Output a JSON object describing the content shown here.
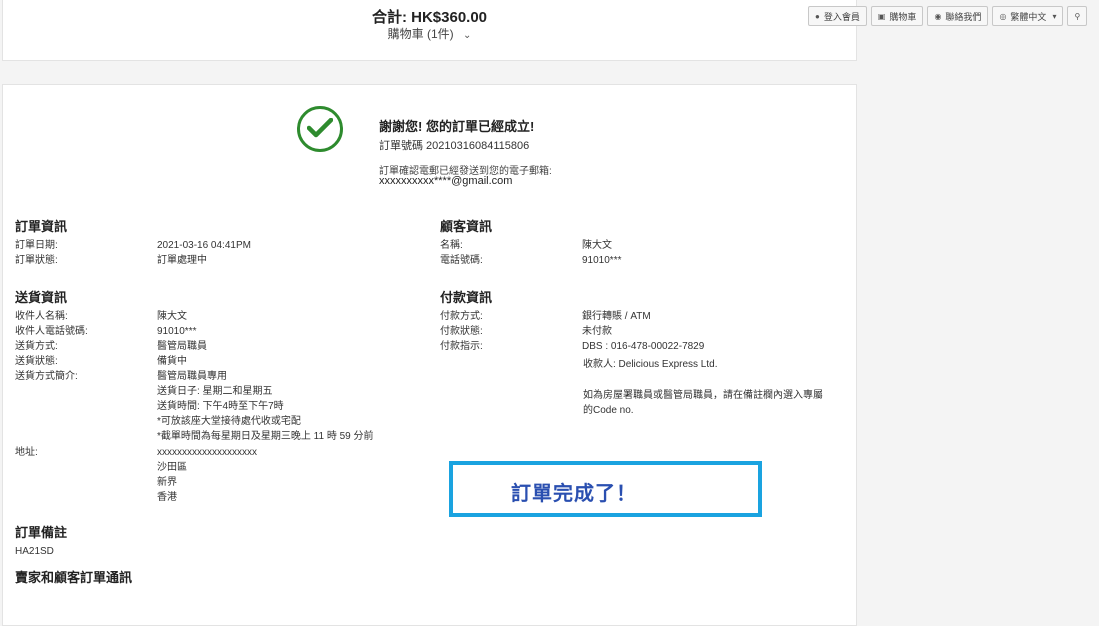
{
  "cart": {
    "total": "合計: HK$360.00",
    "items": "購物車 (1件)"
  },
  "nav": {
    "login": "登入會員",
    "cart": "購物車",
    "contact": "聯絡我們",
    "language": "繁體中文"
  },
  "success": {
    "title": "謝謝您!  您的訂單已經成立!",
    "order_number": "訂單號碼 20210316084115806",
    "confirm_text": "訂單確認電郵已經發送到您的電子郵箱:",
    "email": "xxxxxxxxxx****@gmail.com"
  },
  "order_info": {
    "heading": "訂單資訊",
    "rows": [
      {
        "label": "訂單日期:",
        "value": "2021-03-16 04:41PM"
      },
      {
        "label": "訂單狀態:",
        "value": "訂單處理中"
      }
    ]
  },
  "customer_info": {
    "heading": "顧客資訊",
    "rows": [
      {
        "label": "名稱:",
        "value": "陳大文"
      },
      {
        "label": "電話號碼:",
        "value": "91010***"
      }
    ]
  },
  "delivery_info": {
    "heading": "送貨資訊",
    "rows": [
      {
        "label": "收件人名稱:",
        "value": "陳大文"
      },
      {
        "label": "收件人電話號碼:",
        "value": "91010***"
      },
      {
        "label": "送貨方式:",
        "value": "醫管局職員"
      },
      {
        "label": "送貨狀態:",
        "value": "備貨中"
      },
      {
        "label": "送貨方式簡介:",
        "value": "醫管局職員專用"
      }
    ],
    "desc_lines": [
      "送貨日子: 星期二和星期五",
      "送貨時間: 下午4時至下午7時",
      "*可放該座大堂接待處代收或宅配",
      "*截單時間為每星期日及星期三晚上 11 時 59 分前"
    ],
    "address_label": "地址:",
    "address_lines": [
      "xxxxxxxxxxxxxxxxxxxx",
      "沙田區",
      "新界",
      "香港"
    ]
  },
  "payment_info": {
    "heading": "付款資訊",
    "rows": [
      {
        "label": "付款方式:",
        "value": "銀行轉賬 / ATM"
      },
      {
        "label": "付款狀態:",
        "value": "未付款"
      },
      {
        "label": "付款指示:",
        "value": "DBS : 016-478-00022-7829"
      }
    ],
    "payee": "收款人: Delicious Express Ltd.",
    "note_line1": "如為房屋署職員或醫管局職員，請在備註欄內選入專屬",
    "note_line2": "的Code no."
  },
  "order_notes": {
    "heading": "訂單備註",
    "value": "HA21SD"
  },
  "messages": {
    "heading": "賣家和顧客訂單通訊"
  },
  "overlay": {
    "text": "訂單完成了！"
  },
  "colors": {
    "success": "#2e8b2e",
    "highlight_border": "#1aa3e0",
    "highlight_text": "#2a4fb0"
  }
}
